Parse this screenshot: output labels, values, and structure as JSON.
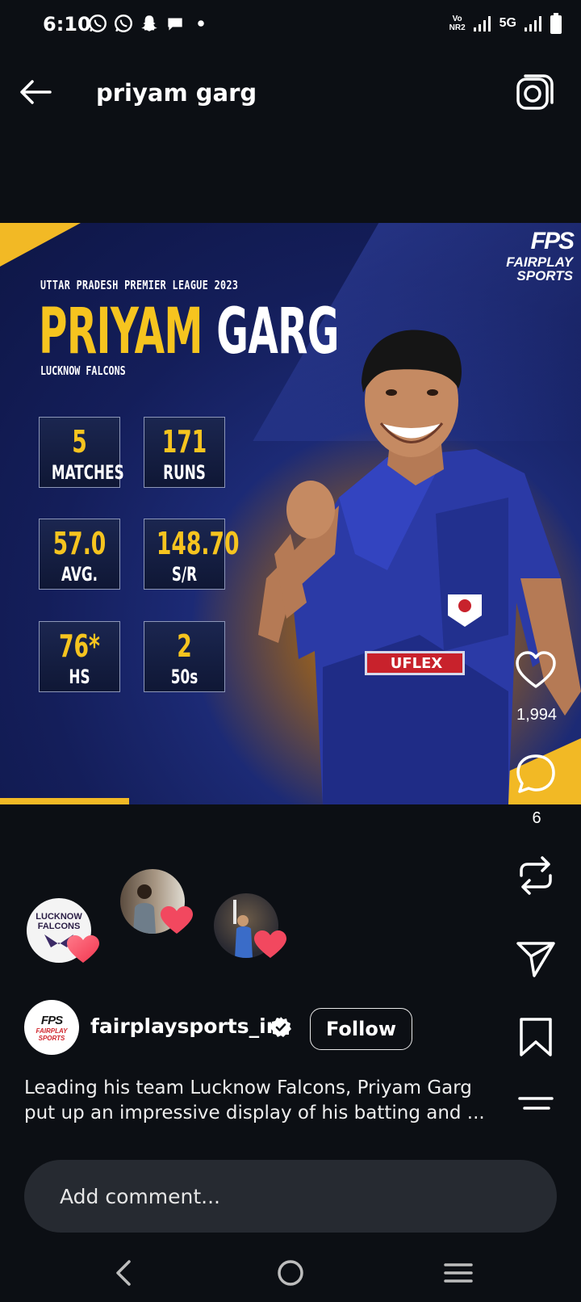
{
  "status_bar": {
    "time": "6:10",
    "volte_top": "Vo",
    "volte_bottom": "NR2",
    "network": "5G"
  },
  "header": {
    "title": "priyam garg"
  },
  "poster": {
    "league": "UTTAR PRADESH PREMIER LEAGUE 2023",
    "first_name": "PRIYAM",
    "last_name": "GARG",
    "team": "LUCKNOW FALCONS",
    "brand_mark": "FPS",
    "brand_line1": "FAIRPLAY",
    "brand_line2": "SPORTS",
    "stats": [
      {
        "value": "5",
        "label": "MATCHES"
      },
      {
        "value": "171",
        "label": "RUNS"
      },
      {
        "value": "57.0",
        "label": "AVG."
      },
      {
        "value": "148.70",
        "label": "S/R"
      },
      {
        "value": "76*",
        "label": "HS"
      },
      {
        "value": "2",
        "label": "50s"
      }
    ],
    "sponsor": "UFLEX",
    "colors": {
      "gold": "#f6c41f",
      "navy": "#141e5a",
      "jersey": "#2a3aa8"
    }
  },
  "actions": {
    "likes": "1,994",
    "comments": "6"
  },
  "reactions": {
    "avatar1_text_line1": "LUCKNOW",
    "avatar1_text_line2": "FALCONS"
  },
  "author": {
    "avatar_mark": "FPS",
    "avatar_line1": "FAIRPLAY",
    "avatar_line2": "SPORTS",
    "username": "fairplaysports_in",
    "follow_label": "Follow"
  },
  "caption": "Leading his team Lucknow Falcons, Priyam Garg put up an impressive display of his batting and ...",
  "comment": {
    "placeholder": "Add comment..."
  }
}
